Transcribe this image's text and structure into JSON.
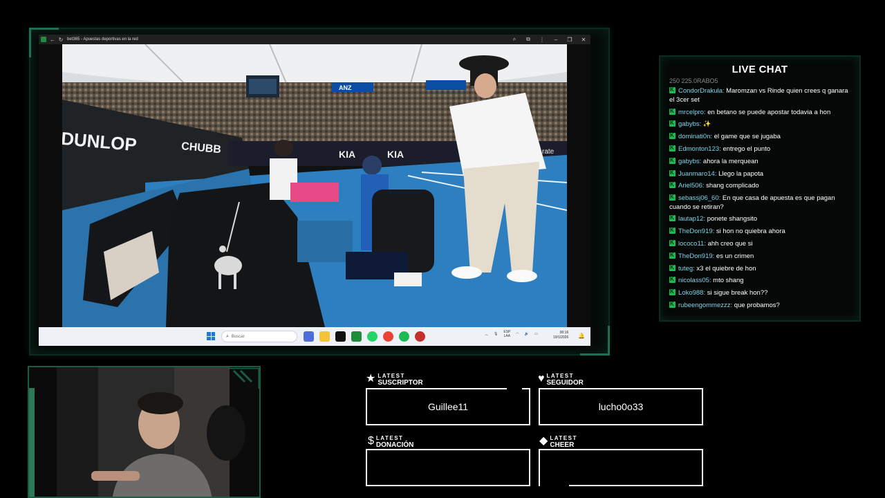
{
  "browser": {
    "title": "bet365 - Apuestas deportivas en la red",
    "back_icon": "arrow-left-icon",
    "reload_icon": "reload-icon"
  },
  "video": {
    "court_sign_1": "DUNLOP",
    "court_sign_2": "CHUBB",
    "sponsor_1": "KIA",
    "sponsor_2": "ANZ",
    "sponsor_3": "rate"
  },
  "taskbar": {
    "search_placeholder": "Buscar",
    "lang_line1": "ESP",
    "lang_line2": "LAA",
    "time": "00:16",
    "date": "19/1/2026"
  },
  "chat": {
    "title": "LIVE CHAT",
    "cut_line": "250 225.0RABO5",
    "messages": [
      {
        "user": "CondorDrakula",
        "text": " Maromzan vs Rinde quien crees q ganara el 3cer set"
      },
      {
        "user": "mrcelpro",
        "text": " en betano se puede apostar todavia a hon"
      },
      {
        "user": "gabybs",
        "text": " ✨"
      },
      {
        "user": "dominati0n",
        "text": " el game que se jugaba"
      },
      {
        "user": "Edmonton123",
        "text": " entrego el punto"
      },
      {
        "user": "gabybs",
        "text": " ahora la merquean"
      },
      {
        "user": "Juanmaro14",
        "text": " Llego la papota"
      },
      {
        "user": "Ariel506",
        "text": " shang complicado"
      },
      {
        "user": "sebassj06_60",
        "text": " En que casa de apuesta es que pagan cuando se retiran?"
      },
      {
        "user": "lautap12",
        "text": " ponete shangsito"
      },
      {
        "user": "TheDon919",
        "text": " si hon no quiebra ahora"
      },
      {
        "user": "lococo11",
        "text": " ahh creo que si"
      },
      {
        "user": "TheDon919",
        "text": " es un crimen"
      },
      {
        "user": "tuteg",
        "text": " x3 el quiebre de hon"
      },
      {
        "user": "nicolass05",
        "text": " mto shang"
      },
      {
        "user": "Loko988",
        "text": " si sigue break hon??"
      },
      {
        "user": "rubeengommezzz",
        "text": " que probamos?"
      }
    ]
  },
  "alerts": {
    "subscriber": {
      "latest": "LATEST",
      "kind": "SUSCRIPTOR",
      "value": "Guillee11",
      "icon": "star-icon"
    },
    "follower": {
      "latest": "LATEST",
      "kind": "SEGUIDOR",
      "value": "lucho0o33",
      "icon": "heart-icon"
    },
    "donation": {
      "latest": "LATEST",
      "kind": "DONACIÓN",
      "value": "",
      "icon": "dollar-icon"
    },
    "cheer": {
      "latest": "LATEST",
      "kind": "CHEER",
      "value": "",
      "icon": "diamond-icon"
    }
  },
  "colors": {
    "accent_green": "#1f6f52",
    "chat_user": "#7fd4e8",
    "badge_green": "#1db954"
  }
}
